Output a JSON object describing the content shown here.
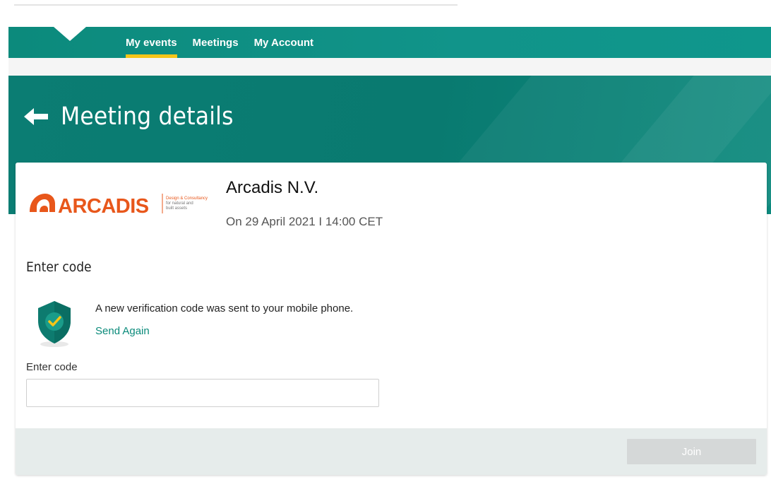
{
  "nav": {
    "items": [
      {
        "label": "My events",
        "active": true
      },
      {
        "label": "Meetings",
        "active": false
      },
      {
        "label": "My Account",
        "active": false
      }
    ],
    "accent_color": "#f5c518"
  },
  "hero": {
    "back_icon": "arrow-left-icon",
    "title": "Meeting details"
  },
  "meeting": {
    "logo_text": "ARCADIS",
    "logo_tagline": "Design & Consultancy for natural and built assets",
    "company_name": "Arcadis N.V.",
    "date_line": "On 29 April 2021 I 14:00 CET"
  },
  "verification": {
    "section_title": "Enter code",
    "icon": "shield-check-icon",
    "message": "A new verification code was sent to your mobile phone.",
    "send_again_label": "Send Again",
    "input_label": "Enter code",
    "input_value": "",
    "input_placeholder": ""
  },
  "footer": {
    "join_label": "Join"
  },
  "colors": {
    "brand_teal": "#0b7d73",
    "link_teal": "#0a8a7a",
    "logo_orange": "#e8571b"
  }
}
